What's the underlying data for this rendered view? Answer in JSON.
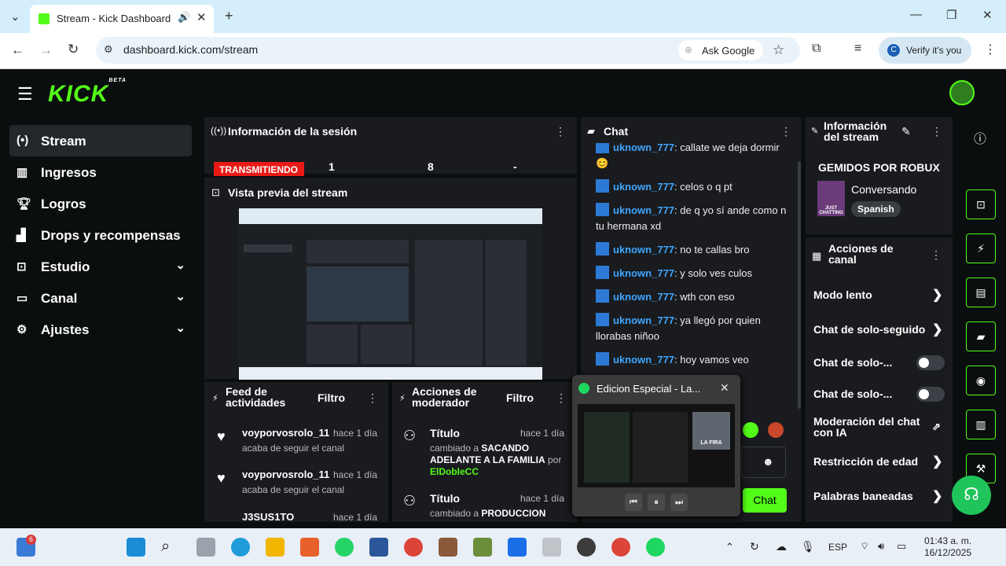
{
  "browser": {
    "tab_title": "Stream - Kick Dashboard",
    "url": "dashboard.kick.com/stream",
    "ask_google": "Ask Google",
    "verify": "Verify it's you",
    "profile_initial": "C"
  },
  "header": {
    "logo": "KICK",
    "logo_badge": "BETA"
  },
  "sidebar": {
    "items": [
      {
        "label": "Stream",
        "icon": "stream-icon"
      },
      {
        "label": "Ingresos",
        "icon": "chart-icon"
      },
      {
        "label": "Logros",
        "icon": "trophy-icon"
      },
      {
        "label": "Drops y recompensas",
        "icon": "gift-icon"
      },
      {
        "label": "Estudio",
        "icon": "studio-icon"
      },
      {
        "label": "Canal",
        "icon": "channel-icon"
      },
      {
        "label": "Ajustes",
        "icon": "gear-icon"
      }
    ]
  },
  "session": {
    "title": "Información de la sesión",
    "status": "TRANSMITIENDO",
    "stat1": "1",
    "stat2": "8",
    "stat3": "-"
  },
  "preview": {
    "title": "Vista previa del stream"
  },
  "feed": {
    "title": "Feed de actividades",
    "filter": "Filtro",
    "items": [
      {
        "user": "voyporvosrolo_11",
        "time": "hace 1 día",
        "desc": "acaba de seguir el canal"
      },
      {
        "user": "voyporvosrolo_11",
        "time": "hace 1 día",
        "desc": "acaba de seguir el canal"
      },
      {
        "user": "J3SUS1TO",
        "time": "hace 1 día"
      }
    ]
  },
  "mod_actions": {
    "title": "Acciones de moderador",
    "filter": "Filtro",
    "items": [
      {
        "title": "Título",
        "time": "hace 1 día",
        "changed": "cambiado a",
        "value": "SACANDO ADELANTE A LA FAMILIA",
        "by": "por",
        "user": "ElDobleCC"
      },
      {
        "title": "Título",
        "time": "hace 1 día",
        "changed": "cambiado a",
        "value": "PRODUCCION"
      }
    ]
  },
  "chat": {
    "title": "Chat",
    "messages": [
      {
        "user": "uknown_777",
        "text": "callate we deja dormir 😊"
      },
      {
        "user": "uknown_777",
        "text": "celos o q pt"
      },
      {
        "user": "uknown_777",
        "text": "de q yo sí ande como n tu hermana xd"
      },
      {
        "user": "uknown_777",
        "text": "no te callas bro"
      },
      {
        "user": "uknown_777",
        "text": "y solo ves culos"
      },
      {
        "user": "uknown_777",
        "text": "wth con eso"
      },
      {
        "user": "uknown_777",
        "text": "ya llegó por quien llorabas niñoo"
      },
      {
        "user": "uknown_777",
        "text": "hoy vamos veo"
      }
    ],
    "send_label": "Chat"
  },
  "stream_info": {
    "title": "Información del stream",
    "stream_title": "GEMIDOS POR ROBUX",
    "category": "Conversando",
    "language": "Spanish",
    "thumb_text": "JUST CHATTING"
  },
  "channel_actions": {
    "title": "Acciones de canal",
    "items": [
      {
        "label": "Modo lento",
        "kind": "chevron"
      },
      {
        "label": "Chat de solo-seguido",
        "kind": "chevron"
      },
      {
        "label": "Chat de solo-...",
        "kind": "toggle"
      },
      {
        "label": "Chat de solo-...",
        "kind": "toggle"
      },
      {
        "label": "Moderación del chat con IA",
        "kind": "external"
      },
      {
        "label": "Restricción de edad",
        "kind": "chevron"
      },
      {
        "label": "Palabras baneadas",
        "kind": "chevron"
      }
    ]
  },
  "spotify": {
    "title": "Edicion Especial - La...",
    "art_label": "LA FIRA"
  },
  "taskbar": {
    "notif_count": "6",
    "lang": "ESP",
    "time": "01:43 a. m.",
    "date": "16/12/2025"
  }
}
